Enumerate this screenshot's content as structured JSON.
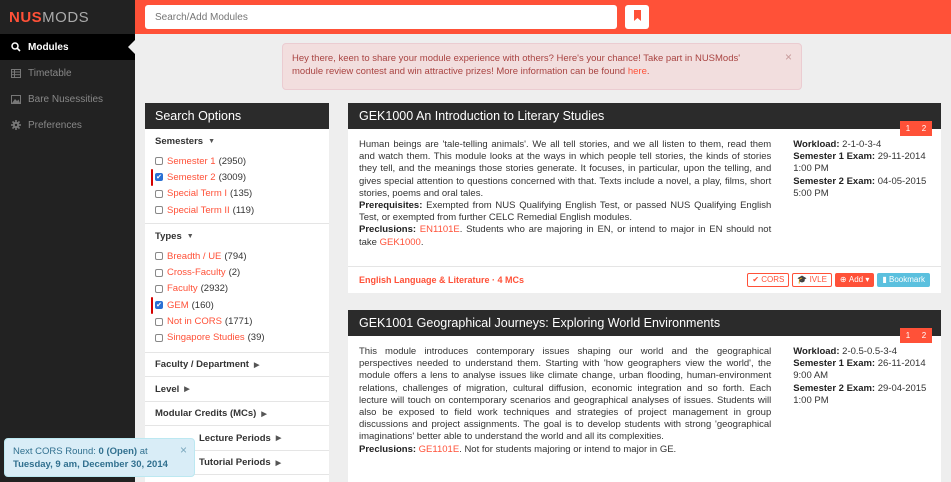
{
  "sidebar": {
    "brand_primary": "NUS",
    "brand_secondary": "MODS",
    "items": [
      {
        "label": "Modules",
        "icon": "search-icon"
      },
      {
        "label": "Timetable",
        "icon": "table-icon"
      },
      {
        "label": "Bare Nusessities",
        "icon": "image-icon"
      },
      {
        "label": "Preferences",
        "icon": "gear-icon"
      }
    ]
  },
  "topbar": {
    "search_placeholder": "Search/Add Modules"
  },
  "alert": {
    "text": "Hey there, keen to share your module experience with others? Here's your chance! Take part in NUSMods' module review contest and win attractive prizes! More information can be found ",
    "link": "here",
    "end": "."
  },
  "options": {
    "title": "Search Options",
    "semesters": {
      "title": "Semesters",
      "items": [
        {
          "label": "Semester 1",
          "count": "(2950)",
          "checked": false
        },
        {
          "label": "Semester 2",
          "count": "(3009)",
          "checked": true
        },
        {
          "label": "Special Term I",
          "count": "(135)",
          "checked": false
        },
        {
          "label": "Special Term II",
          "count": "(119)",
          "checked": false
        }
      ]
    },
    "types": {
      "title": "Types",
      "items": [
        {
          "label": "Breadth / UE",
          "count": "(794)",
          "checked": false
        },
        {
          "label": "Cross-Faculty",
          "count": "(2)",
          "checked": false
        },
        {
          "label": "Faculty",
          "count": "(2932)",
          "checked": false
        },
        {
          "label": "GEM",
          "count": "(160)",
          "checked": true
        },
        {
          "label": "Not in CORS",
          "count": "(1771)",
          "checked": false
        },
        {
          "label": "Singapore Studies",
          "count": "(39)",
          "checked": false
        }
      ]
    },
    "collapsed": [
      "Faculty / Department",
      "Level",
      "Modular Credits (MCs)",
      "Lecture Periods",
      "Tutorial Periods"
    ]
  },
  "modules": [
    {
      "title": "GEK1000 An Introduction to Literary Studies",
      "badges": [
        "1",
        "2"
      ],
      "description": "Human beings are 'tale-telling animals'. We all tell stories, and we all listen to them, read them and watch them. This module looks at the ways in which people tell stories, the kinds of stories they tell, and the meanings those stories generate. It focuses, in particular, upon the telling, and gives special attention to questions concerned with that. Texts include a novel, a play, films, short stories, poems and oral tales.",
      "prereq_label": "Prerequisites:",
      "prereq": "Exempted from NUS Qualifying English Test, or passed NUS Qualifying English Test, or exempted from further CELC Remedial English modules.",
      "preclusion_label": "Preclusions:",
      "preclusion_link": "EN1101E",
      "preclusion_text": ". Students who are majoring in EN, or intend to major in EN should not take ",
      "preclusion_link2": "GEK1000",
      "preclusion_end": ".",
      "workload_label": "Workload:",
      "workload": "2-1-0-3-4",
      "sem1_label": "Semester 1 Exam:",
      "sem1": "29-11-2014 1:00 PM",
      "sem2_label": "Semester 2 Exam:",
      "sem2": "04-05-2015 5:00 PM",
      "dept": "English Language & Literature · 4 MCs",
      "btn_cors": "CORS",
      "btn_ivle": "IVLE",
      "btn_add": "Add",
      "btn_bookmark": "Bookmark"
    },
    {
      "title": "GEK1001 Geographical Journeys: Exploring World Environments",
      "badges": [
        "1",
        "2"
      ],
      "description": "This module introduces contemporary issues shaping our world and the geographical perspectives needed to understand them. Starting with 'how geographers view the world', the module offers a lens to analyse issues like climate change, urban flooding, human-environment relations, challenges of migration, cultural diffusion, economic integration and so forth. Each lecture will touch on contemporary scenarios and geographical analyses of issues. Students will also be exposed to field work techniques and strategies of project management in group discussions and project assignments. The goal is to develop students with strong 'geographical imaginations' better able to understand the world and all its complexities.",
      "preclusion_label": "Preclusions:",
      "preclusion_link": "GE1101E",
      "preclusion_text": ". Not for students majoring or intend to major in GE.",
      "workload_label": "Workload:",
      "workload": "2-0.5-0.5-3-4",
      "sem1_label": "Semester 1 Exam:",
      "sem1": "26-11-2014 9:00 AM",
      "sem2_label": "Semester 2 Exam:",
      "sem2": "29-04-2015 1:00 PM"
    }
  ],
  "toast": {
    "prefix": "Next CORS Round: ",
    "round": "0 (Open)",
    "mid": " at",
    "when": "Tuesday, 9 am, December 30, 2014"
  },
  "colors": {
    "accent": "#ff5138",
    "dark": "#222222",
    "header": "#2b2b2b",
    "check": "#2a70d4"
  }
}
